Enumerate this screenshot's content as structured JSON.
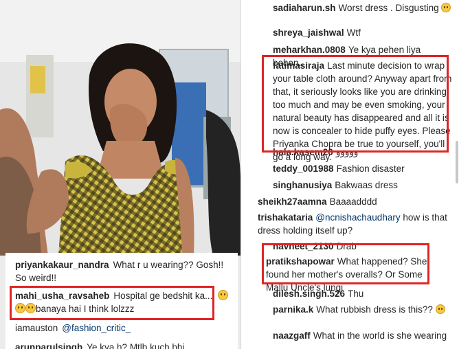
{
  "left_comments": [
    {
      "user": "priyankakaur_nandra",
      "text": "What r u wearing?? Gosh!! So weird!!"
    },
    {
      "user": "mahi_usha_ravsaheb",
      "text_a": "Hospital ge bedshit ka....",
      "text_b": "banaya hai I think lolzzz",
      "emoji": "grinning-sweat-emoji"
    },
    {
      "user": "iamauston",
      "mention": "@fashion_critic_"
    },
    {
      "user": "arunparulsingh",
      "text": "Ye kya h? Mtlb kuch bhi"
    }
  ],
  "right_comments": [
    {
      "user": "sadiaharun.sh",
      "text": "Worst dress . Disgusting",
      "emoji": "confounded-emoji"
    },
    {
      "user": "shreya_jaishwal",
      "text": "Wtf"
    },
    {
      "user": "meharkhan.0808",
      "text": "Ye kya pehen liya behen.."
    },
    {
      "user": "fatimasiraja",
      "text": "Last minute decision to wrap your table cloth around? Anyway apart from that, it seriously looks like you are drinking too much and may be even smoking, your natural beauty has disappeared and all it is now is concealer to hide puffy eyes. Please Priyanka Chopra be true to yourself, you'll go a long way."
    },
    {
      "user": "hala.kasem20",
      "text": "ووووو"
    },
    {
      "user": "teddy_001988",
      "text": "Fashion disaster"
    },
    {
      "user": "singhanusiya",
      "text": "Bakwaas dress"
    },
    {
      "user": "sheikh27aamna",
      "text": "Baaaadddd"
    },
    {
      "user": "trishakataria",
      "mention": "@ncnishachaudhary",
      "text": "how is that dress holding itself up?"
    },
    {
      "user": "navneet_2130",
      "text": "Drab"
    },
    {
      "user": "pratikshapowar",
      "text": "What happened? She found her mother's overalls? Or Some Mallu Uncle's lungi"
    },
    {
      "user": "dilesh.singh.526",
      "text": "Thu"
    },
    {
      "user": "parnika.k",
      "text": "What rubbish dress is this??",
      "emoji": "astonished-emoji"
    },
    {
      "user": "naazgaff",
      "text": "What in the world is she wearing"
    }
  ],
  "colors": {
    "highlight": "#e02424",
    "dress": "#cdb532",
    "mention": "#003569"
  }
}
